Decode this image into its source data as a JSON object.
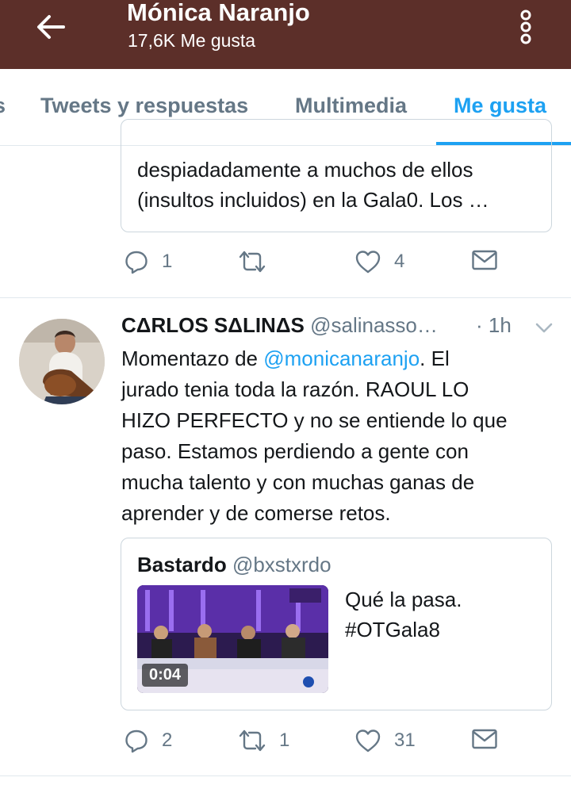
{
  "header": {
    "title": "Mónica Naranjo",
    "subtitle": "17,6K Me gusta"
  },
  "tabs": [
    {
      "label": "Tweets y respuestas"
    },
    {
      "label": "Multimedia"
    },
    {
      "label": "Me gusta"
    }
  ],
  "tweet1": {
    "quote_lines": [
      "despiadadamente a muchos de ellos",
      "(insultos incluidos) en la Gala0. Los …"
    ],
    "replies": "1",
    "retweets": "",
    "likes": "4"
  },
  "tweet2": {
    "name": "CΔRLOS SΔLINΔS",
    "handle": "@salinasso…",
    "time": "· 1h",
    "body": {
      "line1_prefix": "Momentazo de ",
      "line1_mention": "@monicanaranjo",
      "line1_suffix": ". El",
      "line2": "jurado tenia toda la razón. RAOUL LO",
      "line3": "HIZO PERFECTO y no se entiende lo que",
      "line4": "paso. Estamos perdiendo a gente con",
      "line5": "mucha talento y con muchas ganas de",
      "line6": "aprender y de comerse retos."
    },
    "quote": {
      "name": "Bastardo",
      "handle": "@bxstxrdo",
      "text_line1": "Qué la pasa.",
      "text_line2": "#OTGala8",
      "video_duration": "0:04"
    },
    "replies": "2",
    "retweets": "1",
    "likes": "31"
  },
  "colors": {
    "header_bg": "#5c2f29",
    "accent": "#1da1f2",
    "muted": "#657786"
  },
  "icons": [
    "back-arrow-icon",
    "overflow-menu-icon",
    "reply-icon",
    "retweet-icon",
    "like-icon",
    "share-mail-icon",
    "chevron-down-icon"
  ]
}
